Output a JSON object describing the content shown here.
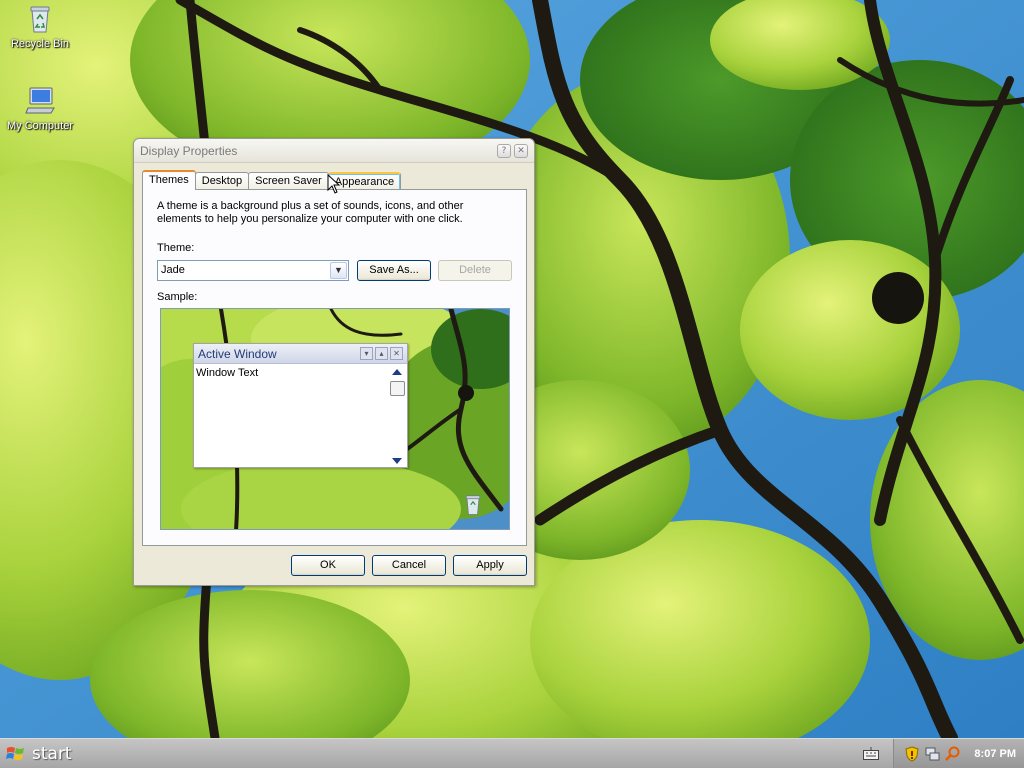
{
  "desktop": {
    "icons": [
      {
        "label": "Recycle Bin",
        "icon": "recycle-bin-icon"
      },
      {
        "label": "My Computer",
        "icon": "my-computer-icon"
      }
    ]
  },
  "dialog": {
    "title": "Display Properties",
    "tabs": [
      "Themes",
      "Desktop",
      "Screen Saver",
      "Appearance"
    ],
    "active_tab": "Themes",
    "description": "A theme is a background plus a set of sounds, icons, and other elements to help you personalize your computer with one click.",
    "theme_label": "Theme:",
    "theme_value": "Jade",
    "save_as_label": "Save As...",
    "delete_label": "Delete",
    "sample_label": "Sample:",
    "sample_window": {
      "title": "Active Window",
      "text": "Window Text"
    },
    "ok_label": "OK",
    "cancel_label": "Cancel",
    "apply_label": "Apply"
  },
  "taskbar": {
    "start_label": "start",
    "clock": "8:07 PM"
  },
  "colors": {
    "leaf": "#8cc63f",
    "branch": "#1e1a12",
    "sky": "#3d8fd1",
    "taskbar": "#b0b0b0"
  }
}
